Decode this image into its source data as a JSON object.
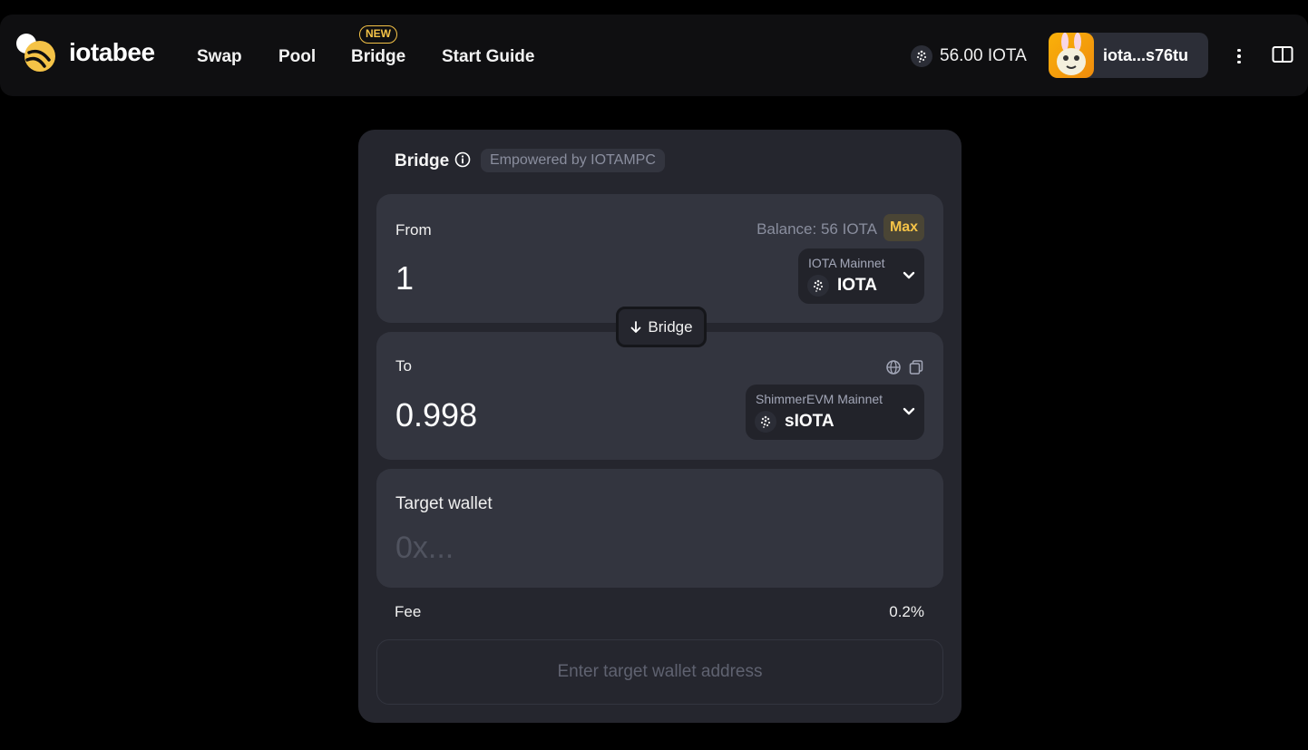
{
  "navbar": {
    "brand": "iotabee",
    "items": [
      {
        "label": "Swap"
      },
      {
        "label": "Pool"
      },
      {
        "label": "Bridge",
        "badge": "NEW"
      },
      {
        "label": "Start Guide"
      }
    ],
    "balance": "56.00 IOTA",
    "account": "iota...s76tu"
  },
  "bridge": {
    "title": "Bridge",
    "powered_by": "Empowered by IOTAMPC",
    "from": {
      "label": "From",
      "balance": "Balance: 56 IOTA",
      "max_label": "Max",
      "amount": "1",
      "chain": "IOTA Mainnet",
      "token": "IOTA"
    },
    "swap_button": "Bridge",
    "to": {
      "label": "To",
      "amount": "0.998",
      "chain": "ShimmerEVM Mainnet",
      "token": "sIOTA"
    },
    "target": {
      "label": "Target wallet",
      "placeholder": "0x..."
    },
    "fee": {
      "label": "Fee",
      "value": "0.2%"
    },
    "submit": "Enter target wallet address"
  },
  "colors": {
    "accent": "#f5c347",
    "card": "#25262e",
    "panel": "#33353f",
    "muted": "#8a8e9e"
  }
}
